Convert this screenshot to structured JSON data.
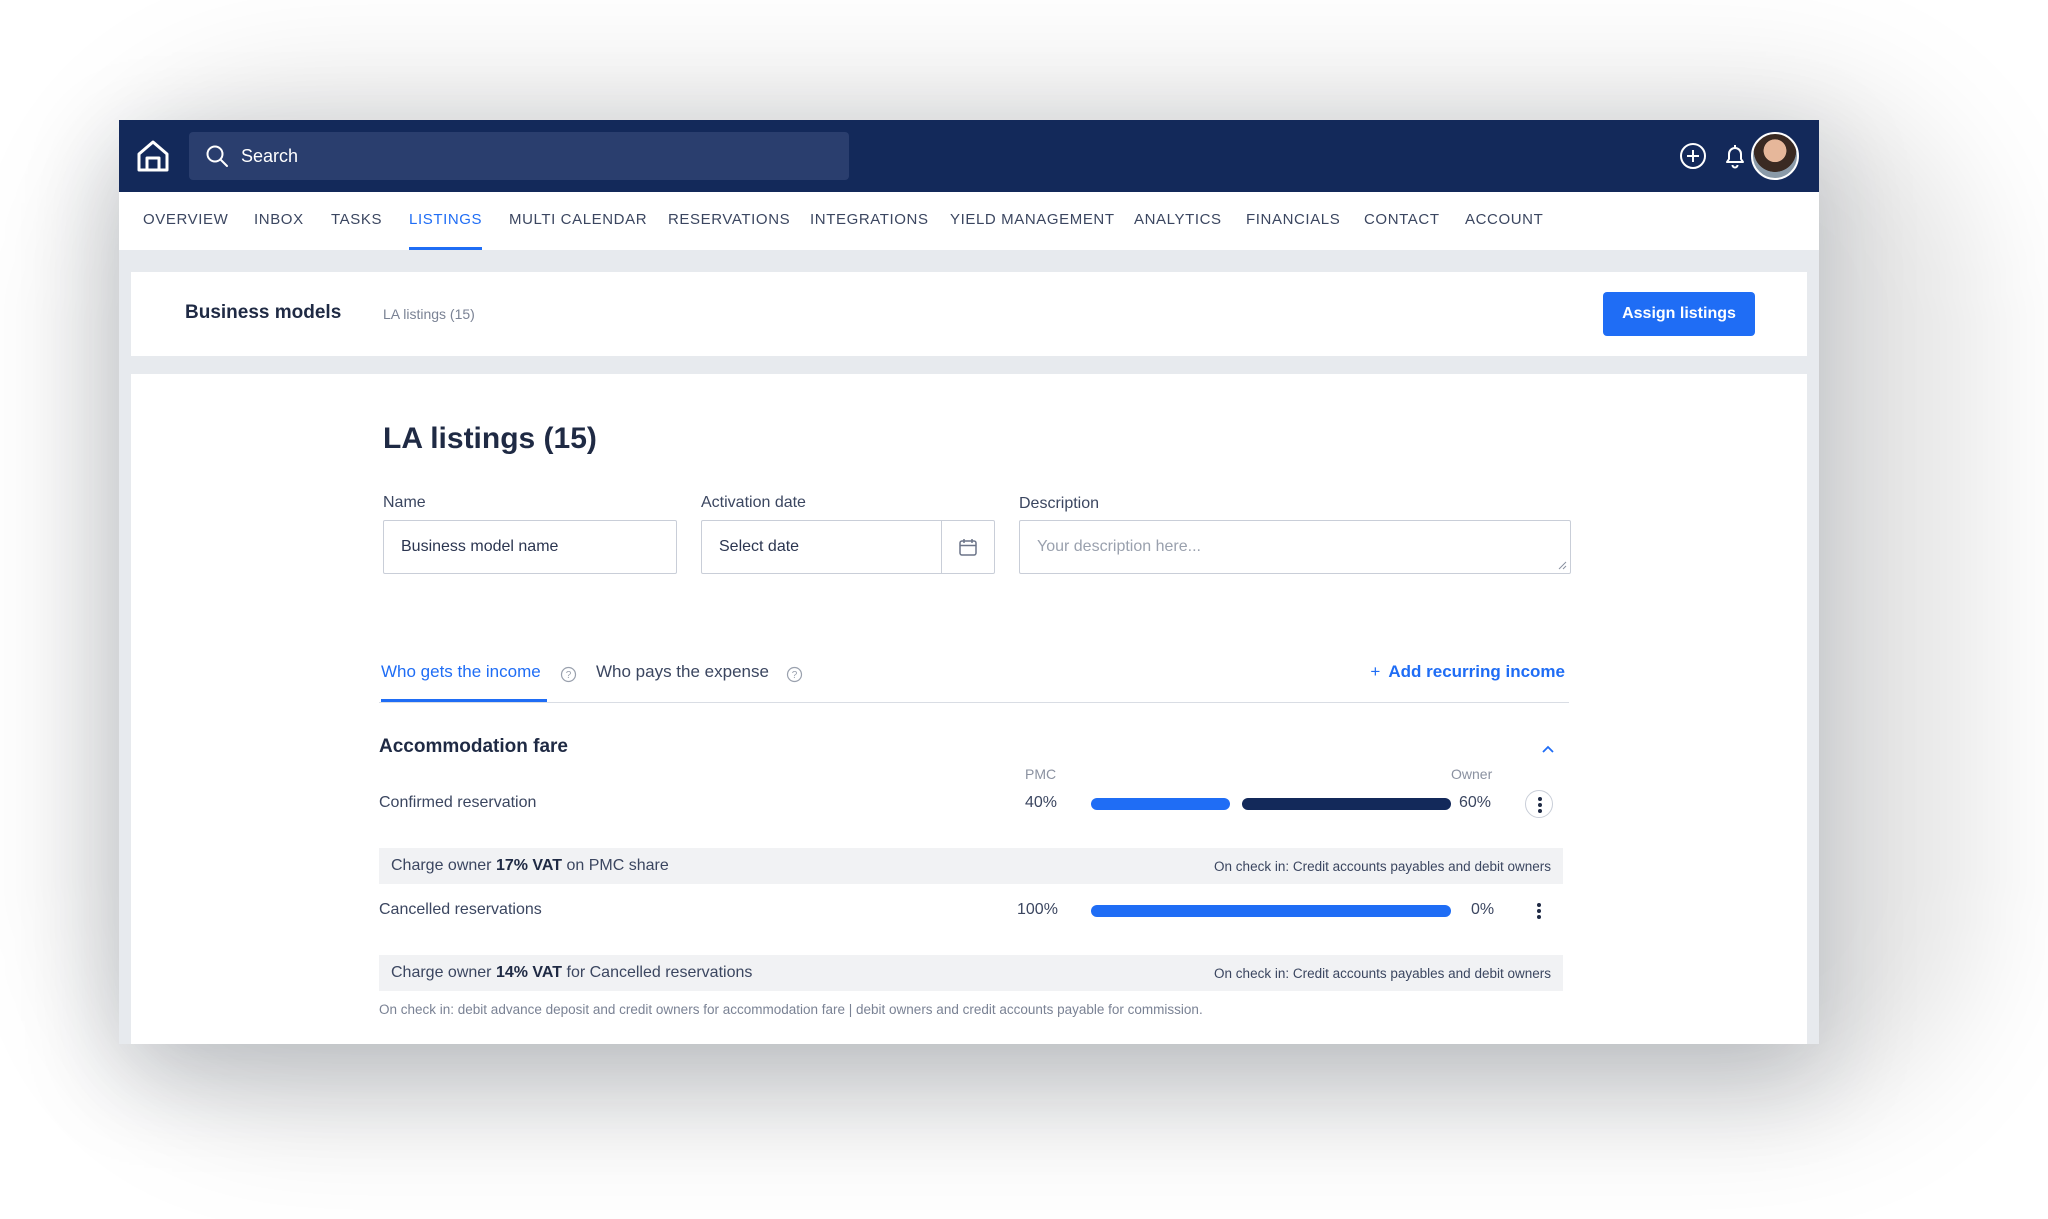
{
  "search": {
    "placeholder": "Search"
  },
  "nav": [
    {
      "label": "OVERVIEW"
    },
    {
      "label": "INBOX"
    },
    {
      "label": "TASKS"
    },
    {
      "label": "LISTINGS"
    },
    {
      "label": "MULTI CALENDAR"
    },
    {
      "label": "RESERVATIONS"
    },
    {
      "label": "INTEGRATIONS"
    },
    {
      "label": "YIELD MANAGEMENT"
    },
    {
      "label": "ANALYTICS"
    },
    {
      "label": "FINANCIALS"
    },
    {
      "label": "CONTACT"
    },
    {
      "label": "ACCOUNT"
    }
  ],
  "nav_active": "LISTINGS",
  "header": {
    "title": "Business models",
    "breadcrumb": "LA listings (15)",
    "assign_button": "Assign listings"
  },
  "form": {
    "page_title": "LA listings (15)",
    "name_label": "Name",
    "name_value": "Business model name",
    "activation_label": "Activation date",
    "activation_value": "Select date",
    "description_label": "Description",
    "description_placeholder": "Your description here..."
  },
  "tabs": {
    "income": "Who gets the income",
    "expense": "Who pays the expense",
    "add_recurring": "Add recurring income"
  },
  "section": {
    "title": "Accommodation fare",
    "pmc_caption": "PMC",
    "owner_caption": "Owner",
    "rows": [
      {
        "label": "Confirmed reservation",
        "pmc_pct": "40%",
        "owner_pct": "60%",
        "pmc_share": 0.4,
        "vat_prefix": "Charge owner ",
        "vat_bold": "17% VAT",
        "vat_suffix": " on PMC share",
        "vat_note": "On check in: Credit accounts payables and debit owners"
      },
      {
        "label": "Cancelled reservations",
        "pmc_pct": "100%",
        "owner_pct": "0%",
        "pmc_share": 1.0,
        "vat_prefix": "Charge owner ",
        "vat_bold": "14% VAT",
        "vat_suffix": " for Cancelled reservations",
        "vat_note": "On check in: Credit accounts payables and debit owners"
      }
    ],
    "footnote": "On check in:  debit advance deposit and credit owners for accommodation fare | debit owners and credit accounts payable for commission."
  },
  "colors": {
    "navy": "#13295a",
    "accent_blue": "#1f6df5",
    "strip_gray": "#f1f2f4"
  },
  "icons": [
    "home-logo-icon",
    "search-icon",
    "plus-circle-icon",
    "bell-icon",
    "calendar-icon",
    "help-icon",
    "chevron-up-icon",
    "more-vertical-icon"
  ]
}
